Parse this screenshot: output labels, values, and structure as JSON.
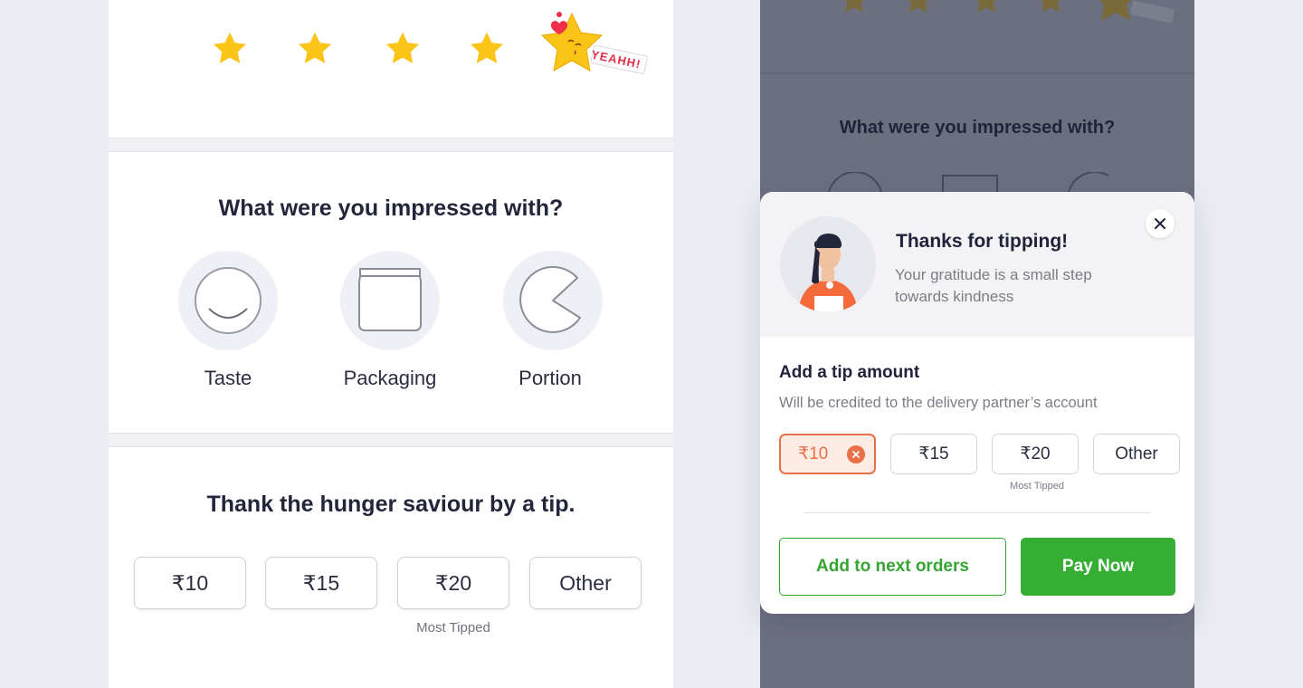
{
  "rating": {
    "stars_filled": 5,
    "stars_total": 5,
    "sticker_text": "YEAHH!",
    "star_color": "#fcc419"
  },
  "impressed": {
    "title": "What were you impressed with?",
    "options": [
      {
        "label": "Taste",
        "icon": "plate-smile-icon"
      },
      {
        "label": "Packaging",
        "icon": "container-icon"
      },
      {
        "label": "Portion",
        "icon": "pie-portion-icon"
      }
    ]
  },
  "tip": {
    "title": "Thank the hunger saviour by a tip.",
    "options": [
      "₹10",
      "₹15",
      "₹20",
      "Other"
    ],
    "most_tipped_label": "Most Tipped"
  },
  "overlay": {
    "background_title": "What were you impressed with?"
  },
  "sheet": {
    "thanks_title": "Thanks for tipping!",
    "thanks_subtitle": "Your gratitude is a small step towards kindness",
    "add_tip_title": "Add a tip amount",
    "add_tip_subtitle": "Will be credited to the delivery partner’s account",
    "options": [
      "₹10",
      "₹15",
      "₹20",
      "Other"
    ],
    "selected_option": "₹10",
    "most_tipped_label": "Most Tipped",
    "secondary_button": "Add to next orders",
    "primary_button": "Pay Now",
    "accent_color": "#e8714a",
    "brand_green": "#36ae34"
  }
}
